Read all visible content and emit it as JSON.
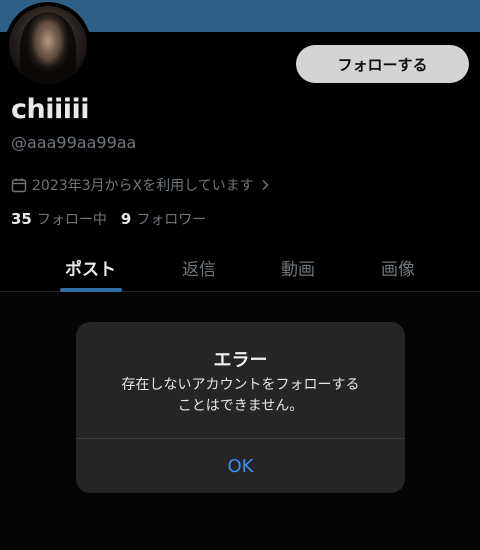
{
  "profile": {
    "display_name": "chiiiii",
    "handle": "@aaa99aa99aa",
    "joined": "2023年3月からXを利用しています",
    "following_count": "35",
    "following_label": "フォロー中",
    "followers_count": "9",
    "followers_label": "フォロワー"
  },
  "actions": {
    "follow_label": "フォローする"
  },
  "tabs": [
    {
      "label": "ポスト",
      "active": true
    },
    {
      "label": "返信",
      "active": false
    },
    {
      "label": "動画",
      "active": false
    },
    {
      "label": "画像",
      "active": false
    }
  ],
  "alert": {
    "title": "エラー",
    "message_line1": "存在しないアカウントをフォローする",
    "message_line2": "ことはできません。",
    "ok_label": "OK"
  },
  "colors": {
    "banner": "#2d5f87",
    "accent_button_text": "#3e8ef0",
    "tab_indicator": "#2f6ea3"
  },
  "icons": {
    "calendar": "calendar-icon",
    "chevron": "chevron-right-icon"
  }
}
